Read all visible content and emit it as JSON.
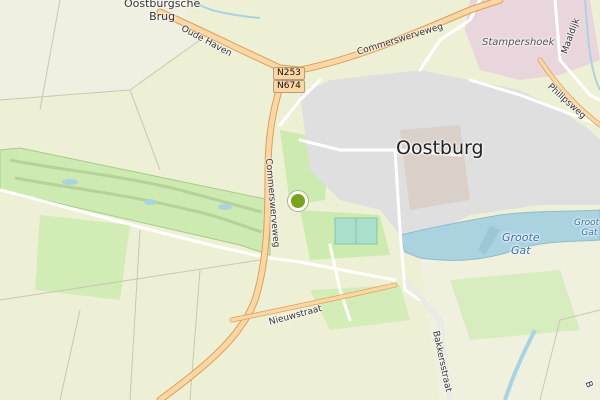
{
  "map": {
    "places": {
      "town": "Oostburg",
      "hamlet": "Oostburgsche Brug",
      "hamlet_line1": "Oostburgsche",
      "hamlet_line2": "Brug",
      "district": "Stampershoek"
    },
    "water": {
      "lake_line1": "Groote",
      "lake_line2": "Gat",
      "lake_small_line1": "Groote",
      "lake_small_line2": "Gat"
    },
    "roads": {
      "oude_haven": "Oude Haven",
      "commerswerveweg_ne": "Commerswerveweg",
      "commerswerveweg_s": "Commerswerveweg",
      "nieuwstraat": "Nieuwstraat",
      "bakkersstraat": "Bakkersstraat",
      "maaldijk": "Maaldijk",
      "philipsweg": "Philipsweg",
      "edge_fragment": "B"
    },
    "shields": [
      "N253",
      "N674"
    ],
    "marker": {
      "label": "location-marker",
      "color": "#7aa21e"
    },
    "colors": {
      "background": "#f2efe9",
      "grass": "#cdebb0",
      "farmland": "#eef0d5",
      "water": "#aad3df",
      "residential": "#e0dfdf",
      "primary_road": "#fcd6a4",
      "primary_casing": "#d9a15a"
    }
  }
}
